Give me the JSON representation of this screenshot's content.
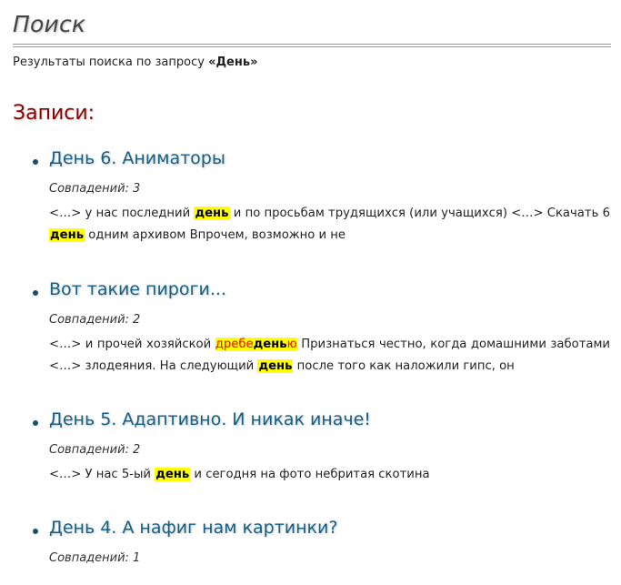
{
  "page": {
    "title": "Поиск",
    "summary_prefix": "Результаты поиска по запросу ",
    "summary_query": "«День»",
    "section_title": "Записи:"
  },
  "results": [
    {
      "title": "День 6. Аниматоры",
      "matches": "Совпадений: 3",
      "snippet": {
        "t1": "<…> у нас последний ",
        "h1": "день",
        "t2": " и по просьбам трудящихся (или учащихся) <…> Скачать 6 ",
        "h2": "день",
        "t3": " одним архивом Впрочем, возможно и не"
      }
    },
    {
      "title": "Вот такие пироги...",
      "matches": "Совпадений: 2",
      "snippet": {
        "t1": "<…> и прочей хозяйской ",
        "h1a": "дребе",
        "h1b": "день",
        "h1c": "ю",
        "t2": " Признаться честно, когда домашними заботами <…> злодеяния. На следующий ",
        "h2": "день",
        "t3": " после того как наложили гипс, он"
      }
    },
    {
      "title": "День 5. Адаптивно. И никак иначе!",
      "matches": "Совпадений: 2",
      "snippet": {
        "t1": "<…> У нас 5-ый ",
        "h1": "день",
        "t2": " и сегодня на фото небритая скотина"
      }
    },
    {
      "title": "День 4. А нафиг нам картинки?",
      "matches": "Совпадений: 1"
    }
  ],
  "colors": {
    "section_title": "#8a0000",
    "link": "#1b5e80",
    "highlight": "#ffff00",
    "partial_match": "#ff0000"
  }
}
